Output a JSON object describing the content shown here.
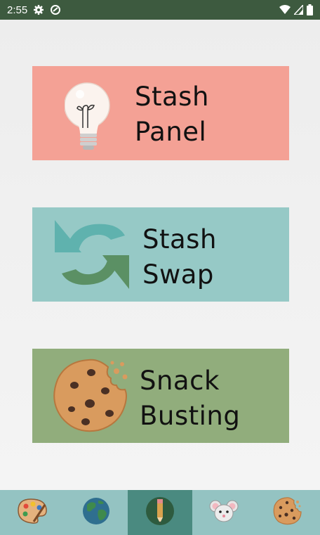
{
  "status_bar": {
    "time": "2:55",
    "icons": [
      "gear-icon",
      "sync-icon",
      "wifi-icon",
      "signal-icon",
      "battery-icon"
    ]
  },
  "cards": [
    {
      "id": "stash-panel",
      "line1": "Stash",
      "line2": "Panel",
      "icon": "lightbulb-icon",
      "color": "#f4a195"
    },
    {
      "id": "stash-swap",
      "line1": "Stash",
      "line2": "Swap",
      "icon": "swap-arrows-icon",
      "color": "#96c9c6"
    },
    {
      "id": "snack-busting",
      "line1": "Snack",
      "line2": "Busting",
      "icon": "cookie-icon",
      "color": "#91ad7c"
    }
  ],
  "bottom_nav": {
    "items": [
      {
        "icon": "palette-icon",
        "active": false
      },
      {
        "icon": "globe-icon",
        "active": false
      },
      {
        "icon": "pencil-icon",
        "active": true
      },
      {
        "icon": "mouse-icon",
        "active": false
      },
      {
        "icon": "cookie-icon",
        "active": false
      }
    ],
    "colors": {
      "background": "#94c3c2",
      "active": "#4a8a80"
    }
  },
  "colors": {
    "status_bar": "#3d5a3f",
    "background": "#f0f0f0"
  }
}
